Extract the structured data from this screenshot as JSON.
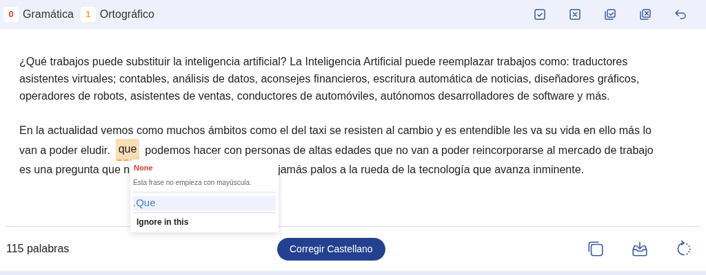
{
  "counters": [
    {
      "count": "0",
      "label": "Gramática",
      "color": "#e53935"
    },
    {
      "count": "1",
      "label": "Ortográfico",
      "color": "#f5a623"
    }
  ],
  "paragraph_1": {
    "lines": [
      "¿Qué trabajos puede substituir la inteligencia artificial? La Inteligencia Artificial puede reemplazar trabajos como: traductores",
      "asistentes virtuales; contables, análisis de datos, aconsejes financieros, escritura automática de noticias, diseñadores gráficos,",
      "operadores de robots, asistentes de ventas, conductores de automóviles, autónomos desarrolladores de software y más."
    ]
  },
  "paragraph_2": {
    "line_1": "En la actualidad vemos como muchos ámbitos como el del taxi se resisten al cambio y es entendible les va su vida en ello más lo",
    "line_2_before": "van a poder eludir.",
    "flagged_word": "que",
    "line_2_after": "podemos hacer con personas de altas edades que no van a poder reincorporarse al mercado de trabajo",
    "line_3_before": "es una pregunta que n",
    "line_3_after": "jamás palos a la rueda de la tecnología que avanza inminente."
  },
  "suggestion_popup": {
    "category": "None",
    "message": "Esta frase no empieza con mayúscula.",
    "suggestion": ".Que",
    "ignore": "Ignore in this"
  },
  "footer": {
    "word_count": "115 palabras",
    "button": "Corregir Castellano"
  }
}
